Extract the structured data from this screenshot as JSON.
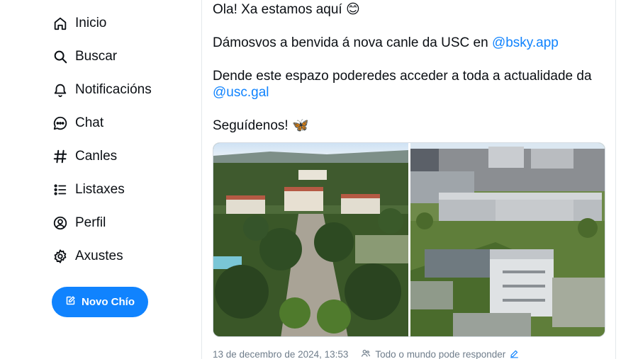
{
  "sidebar": {
    "items": [
      {
        "label": "Inicio",
        "icon": "home-icon"
      },
      {
        "label": "Buscar",
        "icon": "search-icon"
      },
      {
        "label": "Notificacións",
        "icon": "bell-icon"
      },
      {
        "label": "Chat",
        "icon": "chat-icon"
      },
      {
        "label": "Canles",
        "icon": "hashtag-icon"
      },
      {
        "label": "Listaxes",
        "icon": "list-icon"
      },
      {
        "label": "Perfil",
        "icon": "profile-icon"
      },
      {
        "label": "Axustes",
        "icon": "gear-icon"
      }
    ],
    "compose_label": "Novo Chío"
  },
  "post": {
    "line1": "Ola! Xa estamos aquí 😊",
    "line2_text": "Dámosvos a benvida á nova canle da USC en ",
    "line2_link": "@bsky.app",
    "line3_text": "Dende este espazo poderedes acceder a toda a actualidade da",
    "line4_link": "@usc.gal",
    "line5": "Seguídenos! 🦋",
    "images": [
      {
        "alt": "campus-aerial-photo-1"
      },
      {
        "alt": "campus-aerial-photo-2"
      }
    ],
    "timestamp": "13 de decembro de 2024, 13:53",
    "reply_setting": "Todo o mundo pode responder"
  },
  "colors": {
    "accent": "#1083fe",
    "text": "#0b0f14",
    "muted": "#6f7d8b",
    "border": "#e4e8ec"
  }
}
